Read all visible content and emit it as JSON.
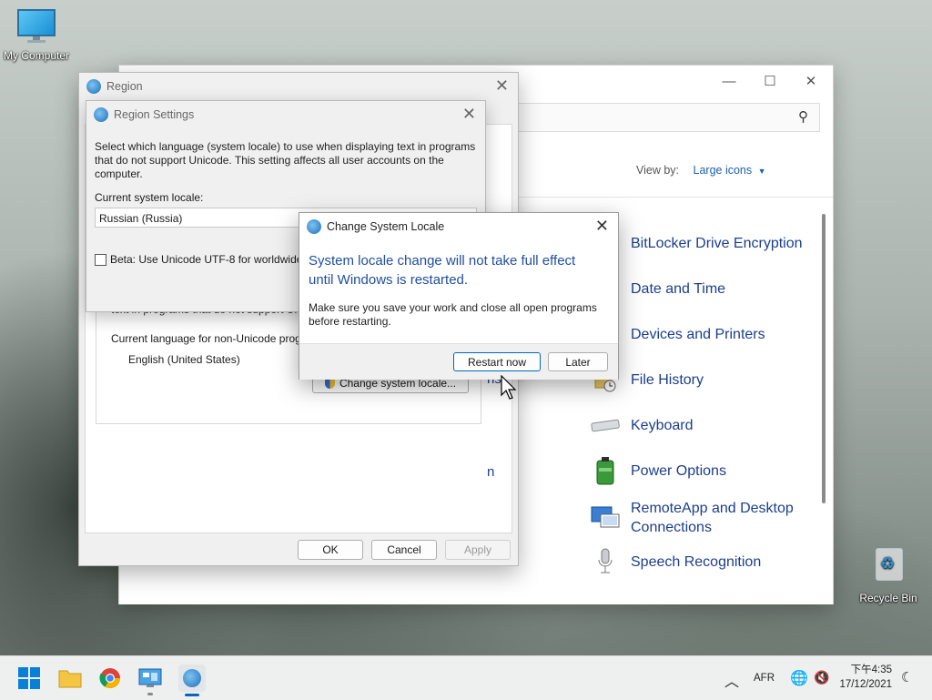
{
  "desktop": {
    "my_computer": "My Computer",
    "recycle_bin": "Recycle Bin"
  },
  "control_panel": {
    "view_by_label": "View by:",
    "view_by_value": "Large icons",
    "items": [
      {
        "label": "BitLocker Drive Encryption",
        "icon": "bitlocker-icon"
      },
      {
        "label": "Date and Time",
        "icon": "clock-icon"
      },
      {
        "label": "Devices and Printers",
        "icon": "printer-icon"
      },
      {
        "label": "File History",
        "icon": "file-history-icon"
      },
      {
        "label": "Keyboard",
        "icon": "keyboard-icon"
      },
      {
        "label": "Power Options",
        "icon": "battery-icon"
      },
      {
        "label": "RemoteApp and Desktop Connections",
        "icon": "remote-desktop-icon"
      },
      {
        "label": "Speech Recognition",
        "icon": "microphone-icon"
      }
    ]
  },
  "region": {
    "title": "Region",
    "nonunicode_text": "text in programs that do not support Unicode.",
    "current_lang_label": "Current language for non-Unicode programs:",
    "current_lang_value": "English (United States)",
    "change_locale_button": "Change system locale...",
    "ok": "OK",
    "cancel": "Cancel",
    "apply": "Apply"
  },
  "region_settings": {
    "title": "Region Settings",
    "description": "Select which language (system locale) to use when displaying text in programs that do not support Unicode. This setting affects all user accounts on the computer.",
    "current_label": "Current system locale:",
    "current_value": "Russian (Russia)",
    "beta_label": "Beta: Use Unicode UTF-8 for worldwide l"
  },
  "change_locale": {
    "title": "Change System Locale",
    "heading": "System locale change will not take full effect until Windows is restarted.",
    "body": "Make sure you save your work and close all open programs before restarting.",
    "restart_now": "Restart now",
    "later": "Later"
  },
  "taskbar": {
    "lang": "AFR",
    "time": "下午4:35",
    "date": "17/12/2021"
  },
  "colors": {
    "accent": "#0067c0",
    "link_blue": "#1c3e8c",
    "heading_blue": "#1f4e9e"
  }
}
